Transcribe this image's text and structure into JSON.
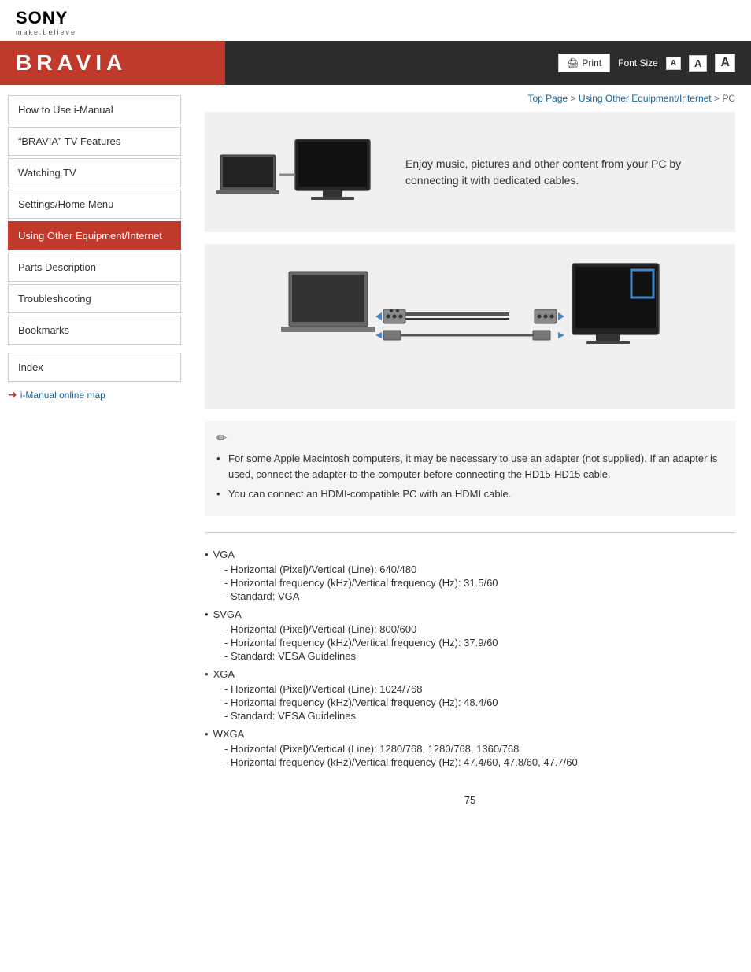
{
  "sony": {
    "logo": "SONY",
    "tagline": "make.believe"
  },
  "banner": {
    "title": "BRAVIA",
    "print_label": "Print",
    "font_size_label": "Font Size",
    "font_small": "A",
    "font_medium": "A",
    "font_large": "A"
  },
  "breadcrumb": {
    "top_page": "Top Page",
    "separator1": " > ",
    "using_other": "Using Other Equipment/Internet",
    "separator2": " > ",
    "current": "PC"
  },
  "sidebar": {
    "items": [
      {
        "id": "how-to-use",
        "label": "How to Use i-Manual"
      },
      {
        "id": "bravia-features",
        "label": "“BRAVIA” TV Features"
      },
      {
        "id": "watching-tv",
        "label": "Watching TV"
      },
      {
        "id": "settings-home",
        "label": "Settings/Home Menu"
      },
      {
        "id": "using-other",
        "label": "Using Other Equipment/Internet",
        "active": true
      },
      {
        "id": "parts-description",
        "label": "Parts Description"
      },
      {
        "id": "troubleshooting",
        "label": "Troubleshooting"
      },
      {
        "id": "bookmarks",
        "label": "Bookmarks"
      }
    ],
    "index_label": "Index",
    "online_map_label": "i-Manual online map"
  },
  "hero": {
    "text": "Enjoy music, pictures and other content from your PC by connecting it with dedicated cables."
  },
  "notes": [
    "For some Apple Macintosh computers, it may be necessary to use an adapter (not supplied). If an adapter is used, connect the adapter to the computer before connecting the HD15-HD15 cable.",
    "You can connect an HDMI-compatible PC with an HDMI cable."
  ],
  "specs": [
    {
      "name": "VGA",
      "items": [
        "Horizontal (Pixel)/Vertical (Line): 640/480",
        "Horizontal frequency (kHz)/Vertical frequency (Hz): 31.5/60",
        "Standard: VGA"
      ]
    },
    {
      "name": "SVGA",
      "items": [
        "Horizontal (Pixel)/Vertical (Line): 800/600",
        "Horizontal frequency (kHz)/Vertical frequency (Hz): 37.9/60",
        "Standard: VESA Guidelines"
      ]
    },
    {
      "name": "XGA",
      "items": [
        "Horizontal (Pixel)/Vertical (Line): 1024/768",
        "Horizontal frequency (kHz)/Vertical frequency (Hz): 48.4/60",
        "Standard: VESA Guidelines"
      ]
    },
    {
      "name": "WXGA",
      "items": [
        "Horizontal (Pixel)/Vertical (Line): 1280/768, 1280/768, 1360/768",
        "Horizontal frequency (kHz)/Vertical frequency (Hz): 47.4/60, 47.8/60, 47.7/60"
      ]
    }
  ],
  "page_number": "75"
}
